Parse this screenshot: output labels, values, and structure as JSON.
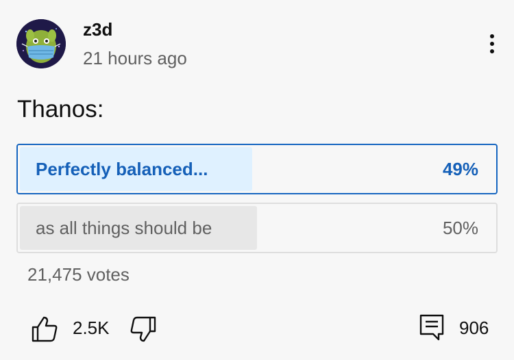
{
  "post": {
    "author": "z3d",
    "timestamp": "21 hours ago",
    "text": "Thanos:"
  },
  "poll": {
    "options": [
      {
        "label": "Perfectly balanced...",
        "percent": "49%",
        "value": 0.49,
        "selected": true
      },
      {
        "label": "as all things should be",
        "percent": "50%",
        "value": 0.5,
        "selected": false
      }
    ],
    "votes": "21,475 votes"
  },
  "actions": {
    "likes": "2.5K",
    "comments": "906"
  },
  "icons": {
    "menu": "more-vert-icon",
    "like": "thumb-up-icon",
    "dislike": "thumb-down-icon",
    "comment": "comment-icon"
  },
  "colors": {
    "selected_accent": "#1565c0",
    "selected_fill": "#dff1ff",
    "unselected_fill": "#e7e7e7",
    "secondary_text": "#606060"
  }
}
